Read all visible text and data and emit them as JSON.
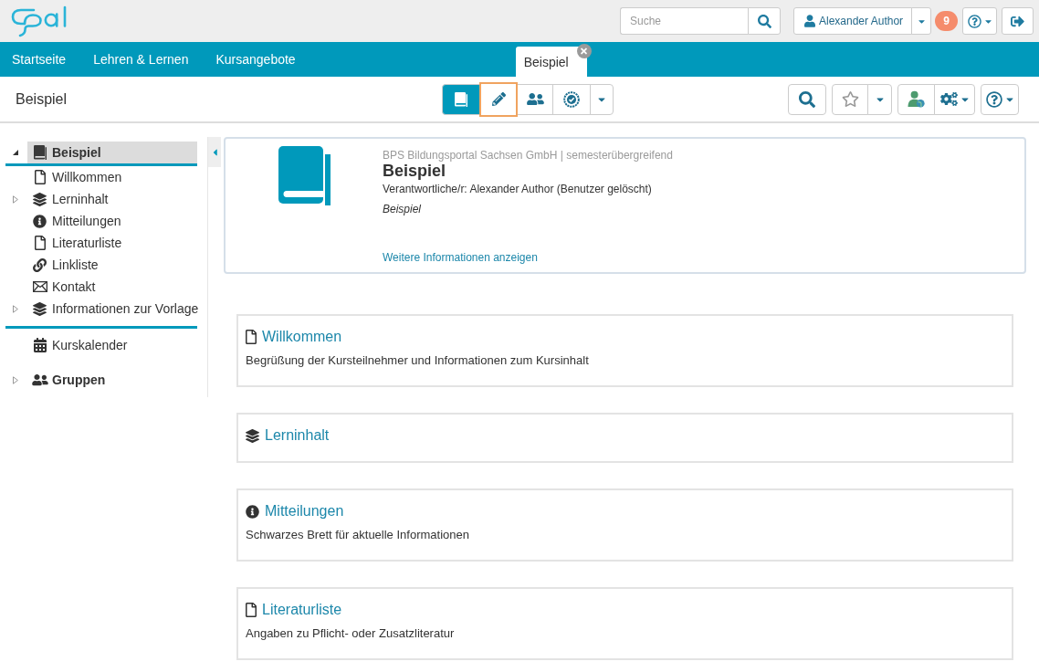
{
  "header": {
    "search": {
      "placeholder": "Suche"
    },
    "user": {
      "name": "Alexander Author"
    },
    "notifications": {
      "count": "9"
    }
  },
  "nav": [
    {
      "label": "Startseite",
      "kind": "link",
      "selected": false
    },
    {
      "label": "Lehren & Lernen",
      "kind": "link",
      "selected": false
    },
    {
      "label": "Kursangebote",
      "kind": "link",
      "selected": false
    },
    {
      "label": "Beispiel",
      "kind": "course-tab",
      "selected": true
    }
  ],
  "course_toolbar": {
    "title": "Beispiel",
    "modes": [
      {
        "kind": "book",
        "selected": true,
        "highlighted": false
      },
      {
        "kind": "pencil",
        "selected": false,
        "highlighted": true
      },
      {
        "kind": "users",
        "selected": false,
        "highlighted": false
      },
      {
        "kind": "badge",
        "selected": false,
        "highlighted": false
      },
      {
        "kind": "caret",
        "selected": false,
        "highlighted": false
      }
    ]
  },
  "sidebar": {
    "tree": {
      "label": "Beispiel",
      "kind": "book",
      "expanded": true,
      "selected": true,
      "children": [
        {
          "label": "Willkommen",
          "kind": "page",
          "selected": false
        },
        {
          "label": "Lerninhalt",
          "kind": "structure",
          "expanded": false,
          "selected": false
        },
        {
          "label": "Mitteilungen",
          "kind": "info",
          "selected": false
        },
        {
          "label": "Literaturliste",
          "kind": "page",
          "selected": false
        },
        {
          "label": "Linkliste",
          "kind": "link",
          "selected": false
        },
        {
          "label": "Kontakt",
          "kind": "mail",
          "selected": false
        },
        {
          "label": "Informationen zur Vorlage",
          "kind": "structure",
          "expanded": false,
          "selected": false
        }
      ]
    },
    "tools": [
      {
        "label": "Kurskalender",
        "kind": "calendar",
        "selected": false
      },
      {
        "label": "Gruppen",
        "kind": "groups",
        "expanded": false,
        "selected": false
      }
    ]
  },
  "course_info": {
    "organization": "BPS Bildungsportal Sachsen GmbH | semesterübergreifend",
    "title": "Beispiel",
    "responsible": "Verantwortliche/r: Alexander Author (Benutzer gelöscht)",
    "description": "Beispiel",
    "more_link": "Weitere Informationen anzeigen"
  },
  "nodes": [
    {
      "kind": "page",
      "title": "Willkommen",
      "description": "Begrüßung der Kursteilnehmer und Informationen zum Kursinhalt"
    },
    {
      "kind": "structure",
      "title": "Lerninhalt"
    },
    {
      "kind": "info",
      "title": "Mitteilungen",
      "description": "Schwarzes Brett für aktuelle Informationen"
    },
    {
      "kind": "page",
      "title": "Literaturliste",
      "description": "Angaben zu Pflicht- oder Zusatzliteratur"
    }
  ]
}
